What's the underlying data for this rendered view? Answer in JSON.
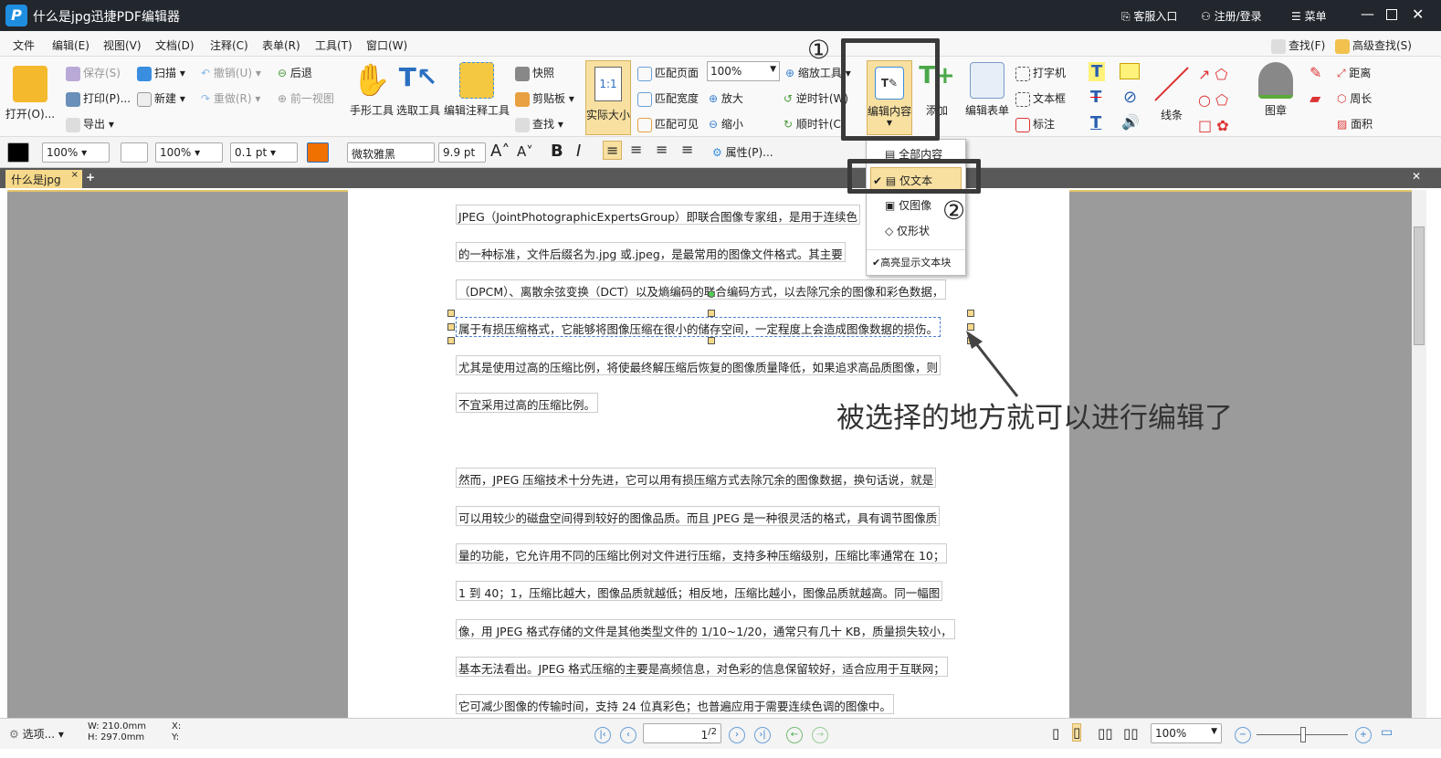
{
  "window": {
    "title": "什么是jpg迅捷PDF编辑器",
    "logo": "P",
    "service": "客服入口",
    "login": "注册/登录",
    "menu": "菜单"
  },
  "menu": [
    "文件",
    "编辑(E)",
    "视图(V)",
    "文档(D)",
    "注释(C)",
    "表单(R)",
    "工具(T)",
    "窗口(W)"
  ],
  "search": {
    "find": "查找(F)",
    "advanced": "高级查找(S)"
  },
  "ribbon": {
    "open": "打开(O)...",
    "save": "保存(S)",
    "print": "打印(P)...",
    "export": "导出",
    "scan": "扫描",
    "new": "新建",
    "undo": "撤销(U)",
    "redo": "重做(R)",
    "back": "后退",
    "prev_view": "前一视图",
    "hand": "手形工具",
    "select": "选取工具",
    "edit_annot": "编辑注释工具",
    "snapshot": "快照",
    "clipboard": "剪贴板",
    "find": "查找",
    "actual": "实际大小",
    "fit_page": "匹配页面",
    "fit_width": "匹配宽度",
    "fit_visible": "匹配可见",
    "zoom_value": "100%",
    "zoom_tool": "缩放工具",
    "zoom_in": "放大",
    "zoom_out": "缩小",
    "ccw": "逆时针(W)",
    "cw": "顺时针(C)",
    "edit_content": "编辑内容",
    "add": "添加",
    "edit_form": "编辑表单",
    "typewriter": "打字机",
    "textbox": "文本框",
    "callout": "标注",
    "lines": "线条",
    "stamp": "图章",
    "distance": "距离",
    "perimeter": "周长",
    "area": "面积"
  },
  "format": {
    "fill_opacity": "100%",
    "stroke_opacity": "100%",
    "line_width": "0.1 pt",
    "font": "微软雅黑",
    "font_size": "9.9 pt",
    "properties": "属性(P)..."
  },
  "tab": {
    "name": "什么是jpg",
    "close": "×",
    "add": "+"
  },
  "dropdown": {
    "all": "全部内容",
    "text_only": "仅文本",
    "image_only": "仅图像",
    "shape_only": "仅形状",
    "highlight": "高亮显示文本块"
  },
  "annotations": {
    "step1": "①",
    "step2": "②",
    "note": "被选择的地方就可以进行编辑了"
  },
  "lines": [
    "JPEG（JointPhotographicExpertsGroup）即联合图像专家组，是用于连续色",
    "的一种标准，文件后缀名为.jpg 或.jpeg，是最常用的图像文件格式。其主要",
    "（DPCM）、离散余弦变换（DCT）以及熵编码的联合编码方式，以去除冗余的图像和彩色数据，",
    "属于有损压缩格式，它能够将图像压缩在很小的储存空间，一定程度上会造成图像数据的损伤。",
    "尤其是使用过高的压缩比例，将使最终解压缩后恢复的图像质量降低，如果追求高品质图像，则",
    "不宜采用过高的压缩比例。",
    "然而，JPEG 压缩技术十分先进，它可以用有损压缩方式去除冗余的图像数据，换句话说，就是",
    "可以用较少的磁盘空间得到较好的图像品质。而且 JPEG 是一种很灵活的格式，具有调节图像质",
    "量的功能，它允许用不同的压缩比例对文件进行压缩，支持多种压缩级别，压缩比率通常在 10；",
    "1 到 40；1，压缩比越大，图像品质就越低；相反地，压缩比越小，图像品质就越高。同一幅图",
    "像，用 JPEG 格式存储的文件是其他类型文件的 1/10~1/20，通常只有几十 KB，质量损失较小，",
    "基本无法看出。JPEG 格式压缩的主要是高频信息，对色彩的信息保留较好，适合应用于互联网；",
    "它可减少图像的传输时间，支持 24 位真彩色；也普遍应用于需要连续色调的图像中。"
  ],
  "status": {
    "options": "选项...",
    "width": "W: 210.0mm",
    "height": "H: 297.0mm",
    "x": "X:",
    "y": "Y:",
    "page": "1",
    "total": "/2",
    "zoom": "100%"
  }
}
